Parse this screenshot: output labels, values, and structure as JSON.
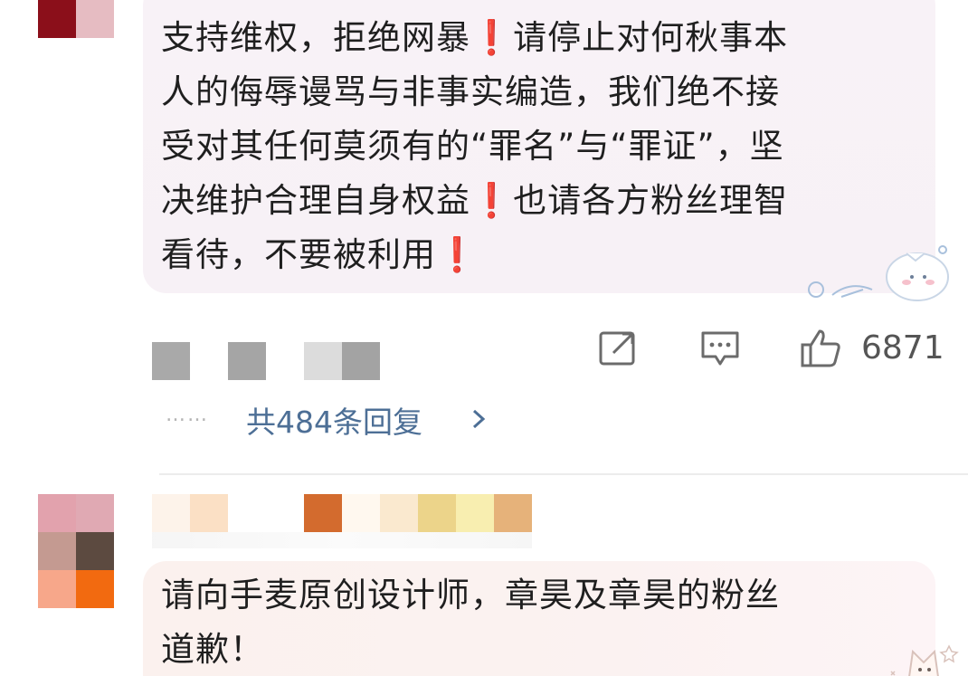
{
  "comment_1": {
    "lines": [
      "支持维权，拒绝网暴❗请停止对何秋事本",
      "人的侮辱谩骂与非事实编造，我们绝不接",
      "受对其任何莫须有的“罪名”与“罪证”，坚",
      "决维护合理自身权益❗也请各方粉丝理智",
      "看待，不要被利用❗"
    ],
    "like_count": "6871",
    "replies_label": "共484条回复",
    "dots": "……",
    "avatar_colors": [
      "#8b0f1a",
      "#e6bcc2"
    ]
  },
  "comment_2": {
    "lines": [
      "请向手麦原创设计师，章昊及章昊的粉丝",
      "道歉！"
    ],
    "avatar_colors": [
      "#e2a2ad",
      "#e0a9b3",
      "#c49a91",
      "#5c4a40",
      "#f7a78a",
      "#f26a10"
    ],
    "name_colors": [
      "#fdf3ea",
      "#fbe0c5",
      "#ffffff",
      "#ffffff",
      "#d36b2e",
      "#fff8ef",
      "#fae9cf",
      "#ecd48a",
      "#f8eeb0",
      "#e6b27a"
    ]
  },
  "icons": {
    "share": "share-icon",
    "comment": "comment-icon",
    "like": "thumbs-up-icon",
    "chevron": "chevron-right-icon"
  },
  "colors": {
    "link": "#4d6f96",
    "text": "#1f1f1f",
    "bubble": "#f8f2f7"
  }
}
